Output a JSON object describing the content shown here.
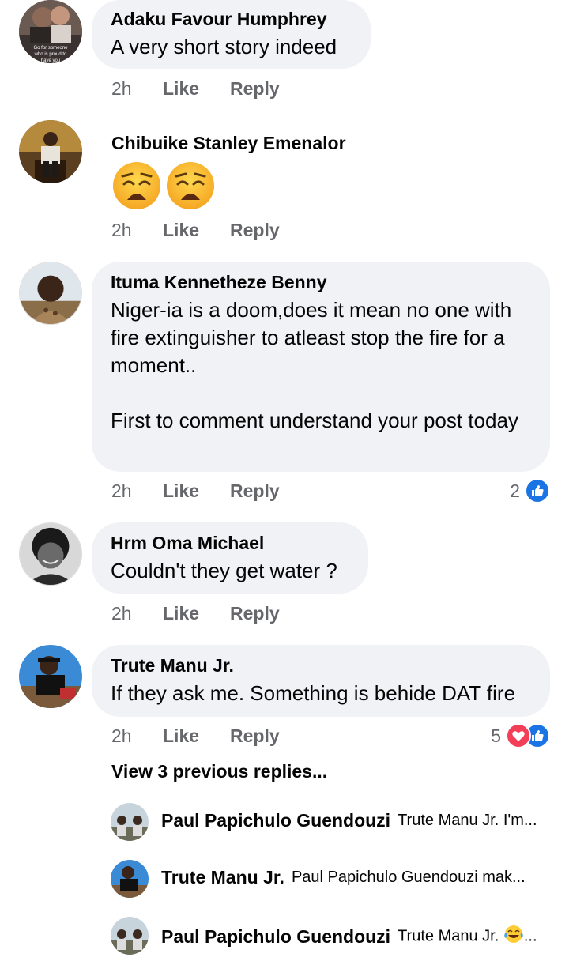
{
  "comments": [
    {
      "author": "Adaku Favour Humphrey",
      "text": "A very short story indeed",
      "avatar_text": [
        "Go for someone",
        "who is proud to",
        "have you"
      ],
      "time": "2h",
      "like_label": "Like",
      "reply_label": "Reply"
    },
    {
      "author": "Chibuike Stanley Emenalor",
      "emojis": [
        "weary-face",
        "weary-face"
      ],
      "time": "2h",
      "like_label": "Like",
      "reply_label": "Reply"
    },
    {
      "author": "Ituma Kennetheze Benny",
      "text": "Niger-ia is a doom,does it mean no one with fire extinguisher to atleast stop the fire for a moment..\n\nFirst to comment understand your post today",
      "time": "2h",
      "like_label": "Like",
      "reply_label": "Reply",
      "reaction_count": "2",
      "reaction_icons": [
        "like-icon"
      ]
    },
    {
      "author": "Hrm Oma Michael",
      "text": "Couldn't they get water ?",
      "time": "2h",
      "like_label": "Like",
      "reply_label": "Reply"
    },
    {
      "author": "Trute Manu Jr.",
      "text": "If they ask me. Something is behide DAT fire",
      "time": "2h",
      "like_label": "Like",
      "reply_label": "Reply",
      "reaction_count": "5",
      "reaction_icons": [
        "love-icon",
        "like-icon"
      ]
    }
  ],
  "view_previous_replies": "View 3 previous replies...",
  "replies": [
    {
      "author": "Paul Papichulo Guendouzi",
      "text": "Trute Manu Jr.  I'm..."
    },
    {
      "author": "Trute Manu Jr.",
      "text": "Paul Papichulo Guendouzi mak..."
    },
    {
      "author": "Paul Papichulo Guendouzi",
      "text": "Trute Manu Jr.",
      "trailing_emoji": "tears-of-joy",
      "trailing_text": "..."
    }
  ],
  "colors": {
    "bubble": "#f0f2f5",
    "action_text": "#65676b",
    "like_blue": "#1b74e4",
    "love_red": "#f33e58"
  }
}
